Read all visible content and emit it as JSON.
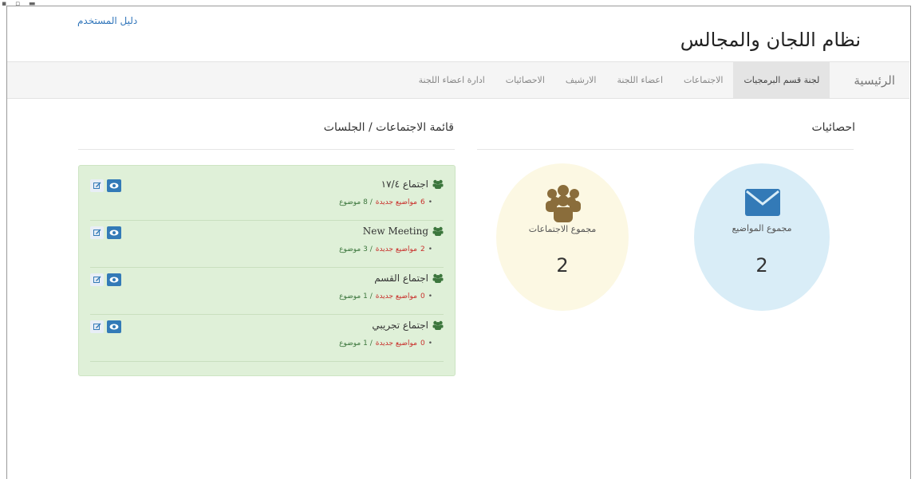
{
  "header": {
    "user_guide": "دليل المستخدم",
    "site_title": "نظام اللجان والمجالس"
  },
  "nav": {
    "brand": "الرئيسية",
    "items": [
      {
        "label": "لجنة قسم البرمجيات",
        "active": true
      },
      {
        "label": "الاجتماعات"
      },
      {
        "label": "اعضاء اللجنة"
      },
      {
        "label": "الارشيف"
      },
      {
        "label": "الاحصائيات"
      },
      {
        "label": "ادارة اعضاء اللجنة"
      }
    ]
  },
  "stats": {
    "title": "احصائيات",
    "topics": {
      "label": "مجموع المواضيع",
      "value": "2",
      "icon": "envelope-icon",
      "color": "#d9edf7"
    },
    "meetings": {
      "label": "مجموع الاجتماعات",
      "value": "2",
      "icon": "users-icon",
      "color": "#fcf8e3"
    }
  },
  "meetings_list": {
    "title": "قائمة الاجتماعات / الجلسات",
    "items": [
      {
        "title": "اجتماع ١٧/٤",
        "count_new": "6",
        "new_text": "مواضيع جديدة",
        "total_text": "/ 8 موضوع"
      },
      {
        "title": "New Meeting",
        "count_new": "2",
        "new_text": "مواضيع جديدة",
        "total_text": "/ 3 موضوع"
      },
      {
        "title": "اجتماع القسم",
        "count_new": "0",
        "new_text": "مواضيع جديدة",
        "total_text": "/ 1 موضوع"
      },
      {
        "title": "اجتماع تجريبي",
        "count_new": "0",
        "new_text": "مواضيع جديدة",
        "total_text": "/ 1 موضوع"
      }
    ]
  }
}
